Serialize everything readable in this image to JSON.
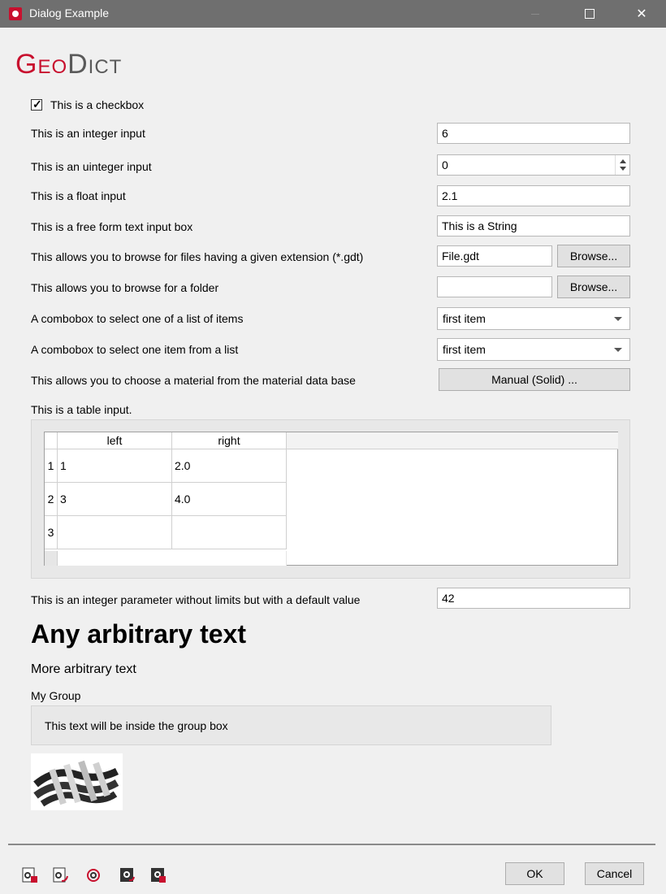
{
  "window": {
    "title": "Dialog Example",
    "icon": "geodict-app-icon"
  },
  "logo": {
    "part1": "Geo",
    "part2": "Dict",
    "brand_color": "#c8102e"
  },
  "checkbox": {
    "label": "This is a checkbox",
    "checked": true
  },
  "rows": {
    "integer": {
      "label": "This is an integer input",
      "value": "6"
    },
    "uinteger": {
      "label": "This is an uinteger input",
      "value": "0"
    },
    "float": {
      "label": "This is a float input",
      "value": "2.1"
    },
    "text": {
      "label": "This is a free form text input box",
      "value": "This is a String"
    },
    "file": {
      "label": "This allows you to browse for files having a given extension (*.gdt)",
      "value": "File.gdt",
      "button": "Browse..."
    },
    "folder": {
      "label": "This allows you to browse for a folder",
      "value": "",
      "button": "Browse..."
    },
    "combo1": {
      "label": "A combobox to select one of a list of items",
      "value": "first item"
    },
    "combo2": {
      "label": "A combobox to select one item from a list",
      "value": "first item"
    },
    "material": {
      "label": "This allows you to choose a material from the material data base",
      "button": "Manual (Solid) ..."
    }
  },
  "table": {
    "label": "This is a table input.",
    "columns": [
      "left",
      "right"
    ],
    "rows": [
      {
        "num": "1",
        "left": "1",
        "right": "2.0"
      },
      {
        "num": "2",
        "left": "3",
        "right": "4.0"
      },
      {
        "num": "3",
        "left": "",
        "right": ""
      }
    ]
  },
  "default_param": {
    "label": "This is an integer parameter without limits but with a default value",
    "value": "42"
  },
  "big_text": "Any arbitrary text",
  "more_text": "More arbitrary text",
  "group": {
    "title": "My Group",
    "content": "This text will be inside the group box"
  },
  "footer": {
    "tools": [
      "load-settings-icon",
      "reload-settings-icon",
      "reset-settings-icon",
      "save-settings-icon",
      "save-as-settings-icon"
    ],
    "ok": "OK",
    "cancel": "Cancel"
  }
}
